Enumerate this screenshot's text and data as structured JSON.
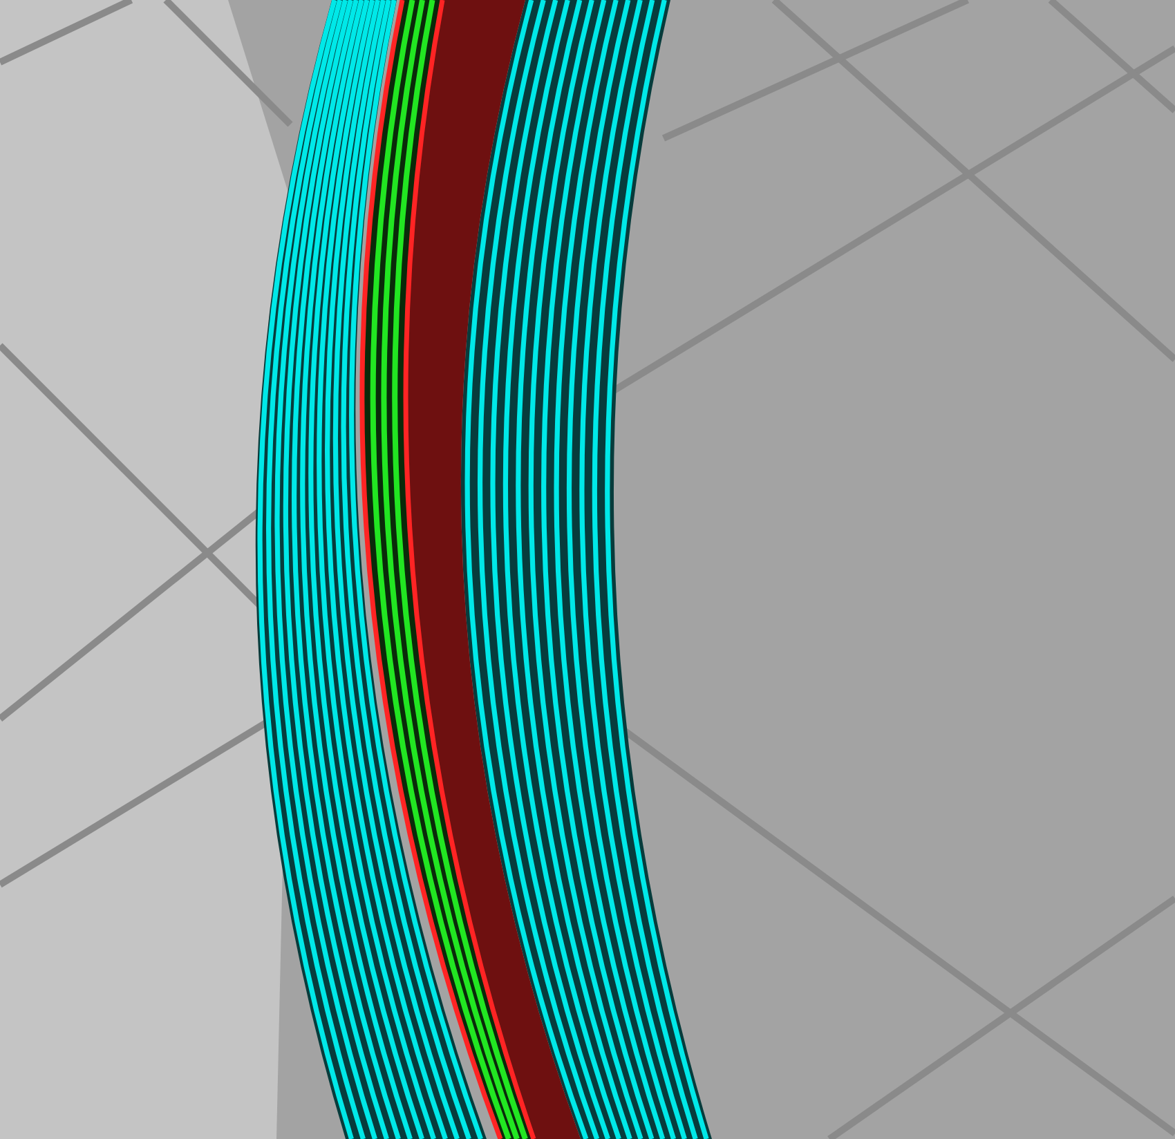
{
  "toolpaths": [
    {
      "kind": "skirt",
      "color": "#00e8e8"
    },
    {
      "kind": "perimeter",
      "color": "#ff2424"
    },
    {
      "kind": "infill",
      "color": "#22e622"
    }
  ]
}
